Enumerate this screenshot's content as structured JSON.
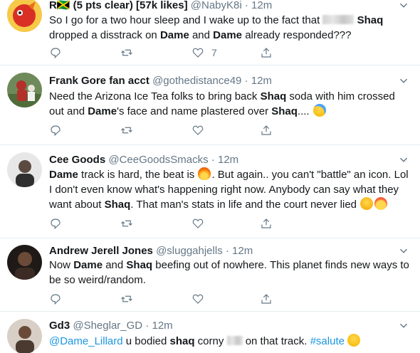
{
  "tweets": [
    {
      "name": "R🇯🇲 (5 pts clear) [57k likes]",
      "handle": "@NabyK8i",
      "dot": "·",
      "time": "12m",
      "segments": [
        {
          "t": "So I go for a two hour sleep and I wake up to the fact that "
        },
        {
          "t": "Shaq",
          "b": true
        },
        {
          "t": " dropped a disstrack on "
        },
        {
          "t": "Dame",
          "b": true
        },
        {
          "t": " and "
        },
        {
          "t": "Dame",
          "b": true
        },
        {
          "t": " already responded???"
        }
      ],
      "like_count": "7",
      "avatar_colors": [
        "#f4b400",
        "#d93025"
      ]
    },
    {
      "name": "Frank Gore fan acct",
      "handle": "@gothedistance49",
      "dot": "·",
      "time": "12m",
      "segments": [
        {
          "t": "Need the Arizona Ice Tea folks to bring back "
        },
        {
          "t": "Shaq",
          "b": true
        },
        {
          "t": " soda with him crossed out and "
        },
        {
          "t": "Dame",
          "b": true
        },
        {
          "t": "'s face and name plastered over "
        },
        {
          "t": "Shaq",
          "b": true
        },
        {
          "t": ".... "
        }
      ],
      "like_count": "",
      "avatar_colors": [
        "#7a8c6e",
        "#a23b2f"
      ]
    },
    {
      "name": "Cee Goods",
      "handle": "@CeeGoodsSmacks",
      "dot": "·",
      "time": "12m",
      "segments": [
        {
          "t": "Dame",
          "b": true
        },
        {
          "t": " track is hard, the beat is "
        },
        {
          "t": ". But again.. you can't \"battle\" an icon. Lol I don't even know what's happening right now. Anybody can say what they want about "
        },
        {
          "t": "Shaq",
          "b": true
        },
        {
          "t": ". That man's stats in life and the court never lied "
        }
      ],
      "like_count": "",
      "avatar_colors": [
        "#d9d9d9",
        "#5b4a3f"
      ]
    },
    {
      "name": "Andrew Jerell Jones",
      "handle": "@sluggahjells",
      "dot": "·",
      "time": "12m",
      "segments": [
        {
          "t": "Now "
        },
        {
          "t": "Dame",
          "b": true
        },
        {
          "t": " and "
        },
        {
          "t": "Shaq",
          "b": true
        },
        {
          "t": " beefing out of nowhere. This planet finds new ways to be so weird/random."
        }
      ],
      "like_count": "",
      "avatar_colors": [
        "#3a2a22",
        "#7b5a45"
      ]
    },
    {
      "name": "Gd3",
      "handle": "@Sheglar_GD",
      "dot": "·",
      "time": "12m",
      "segments": [
        {
          "t": "@Dame_Lillard",
          "link": true
        },
        {
          "t": " u bodied "
        },
        {
          "t": "shaq",
          "b": true
        },
        {
          "t": " corny "
        },
        {
          "t": " on that track. "
        },
        {
          "t": "#salute",
          "link": true
        }
      ],
      "like_count": "",
      "avatar_colors": [
        "#c9b8a8",
        "#5a4033"
      ]
    }
  ],
  "icons": {
    "reply": "reply-icon",
    "retweet": "retweet-icon",
    "like": "like-icon",
    "share": "share-icon",
    "caret": "chevron-down-icon"
  },
  "colors": {
    "text": "#14171a",
    "secondary": "#657786",
    "link": "#1b95e0",
    "divider": "#e6ecf0"
  }
}
